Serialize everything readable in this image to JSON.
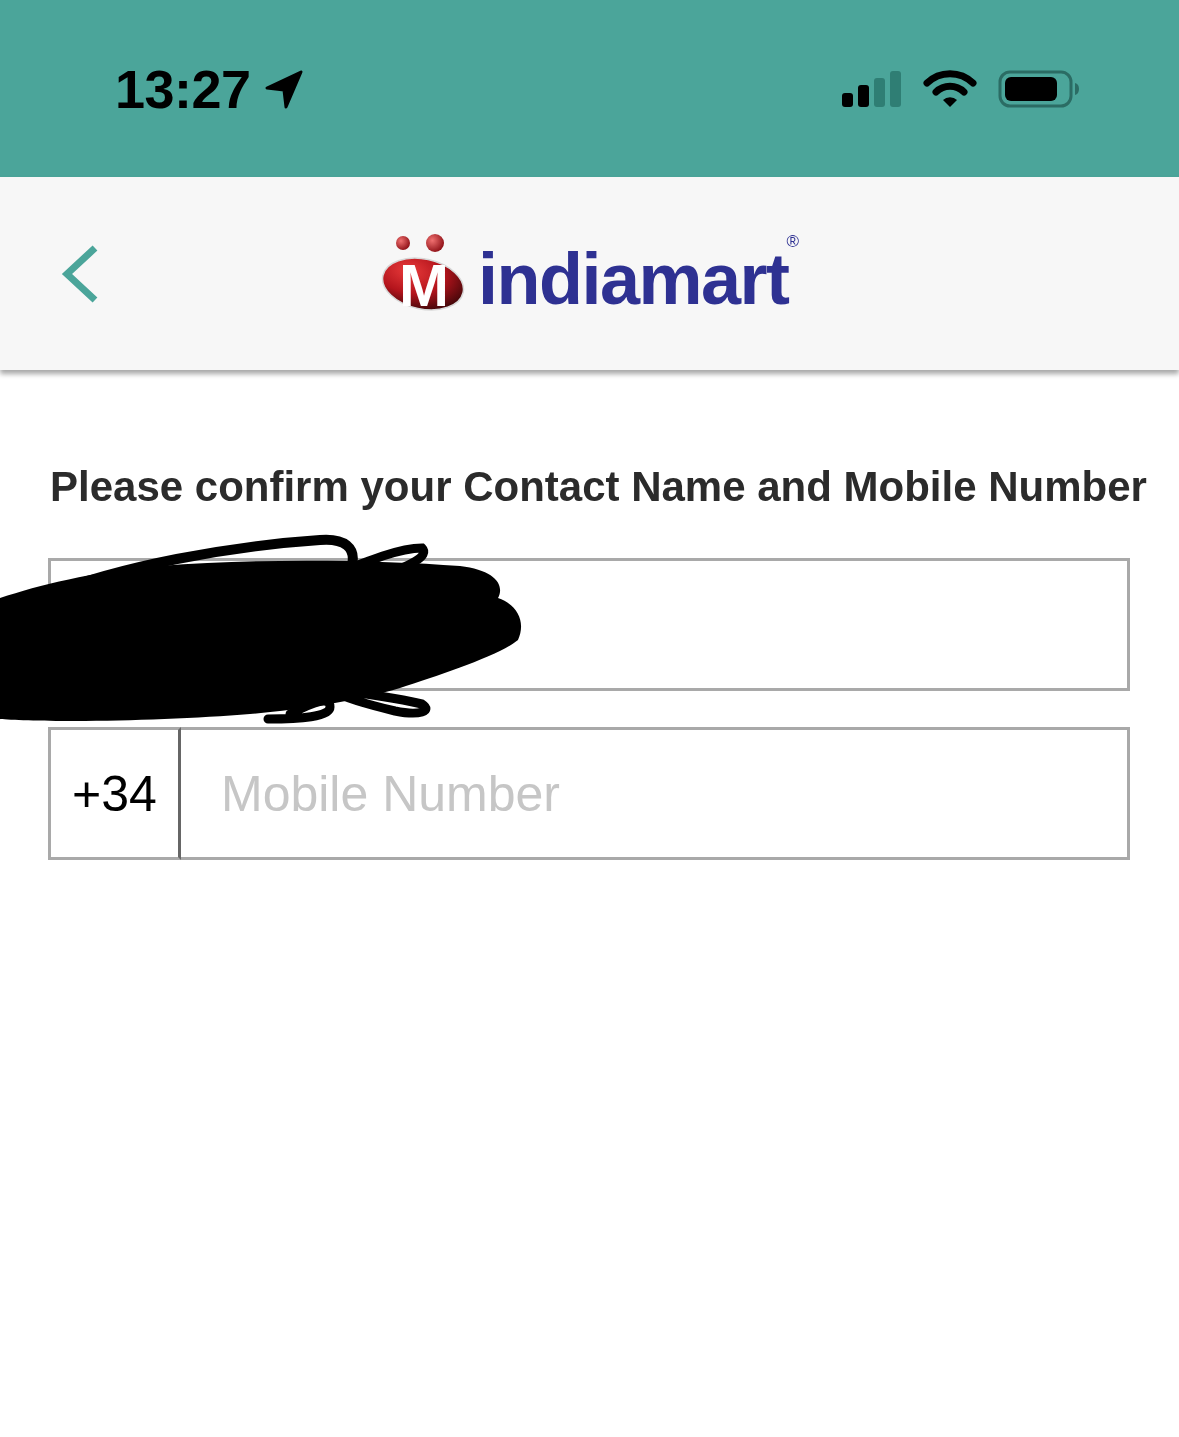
{
  "status_bar": {
    "time": "13:27"
  },
  "header": {
    "logo": {
      "emblem_letter": "M",
      "wordmark": "indiamart",
      "registered": "®"
    }
  },
  "form": {
    "prompt": "Please confirm your Contact Name and Mobile Number",
    "fields": [
      {
        "kind": "name",
        "redacted": true
      },
      {
        "kind": "phone",
        "country_code": "+34",
        "placeholder": "Mobile Number",
        "redacted": false
      }
    ]
  }
}
